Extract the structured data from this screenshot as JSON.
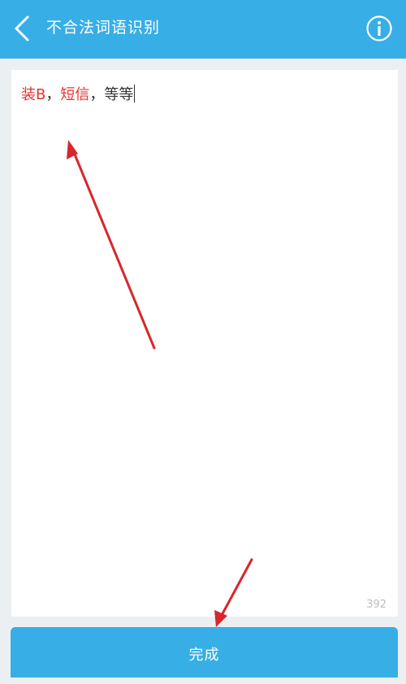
{
  "header": {
    "title": "不合法词语识别",
    "back_icon": "chevron-left-icon",
    "info_icon": "info-circle-icon"
  },
  "editor": {
    "segments": [
      {
        "text": "装B",
        "color": "#e8322f"
      },
      {
        "text": "，",
        "color": "#333333"
      },
      {
        "text": "短信",
        "color": "#e8322f"
      },
      {
        "text": "，等等",
        "color": "#333333"
      }
    ],
    "remaining_count": "392"
  },
  "footer": {
    "done_label": "完成"
  },
  "colors": {
    "accent": "#37aee6",
    "highlight": "#e8322f",
    "annotation_arrow": "#d9262b"
  }
}
